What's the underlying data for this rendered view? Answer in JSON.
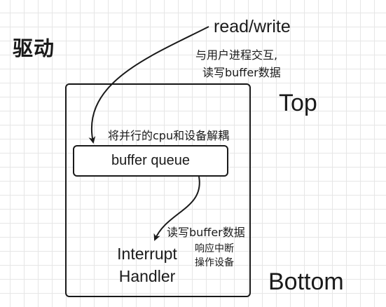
{
  "title": "驱动",
  "layers": {
    "top": "Top",
    "bottom": "Bottom"
  },
  "entry": {
    "label": "read/write",
    "note_line1": "与用户进程交互,",
    "note_line2": "读写buffer数据"
  },
  "buffer": {
    "note": "将并行的cpu和设备解耦",
    "label": "buffer queue"
  },
  "interrupt": {
    "rw_note": "读写buffer数据",
    "respond_note": "响应中断",
    "operate_note": "操作设备",
    "handler_line1": "Interrupt",
    "handler_line2": "Handler"
  },
  "colors": {
    "stroke": "#1a1a1a",
    "grid": "#e6e6e6",
    "background": "#ffffff"
  }
}
